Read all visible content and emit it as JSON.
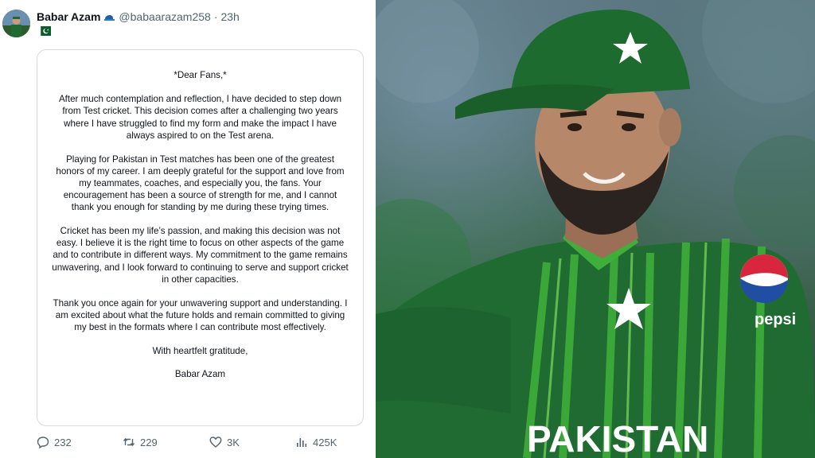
{
  "tweet": {
    "display_name": "Babar Azam",
    "handle": "@babaarazam258",
    "separator": "·",
    "time": "23h",
    "verified_icon": "cricket-cap-icon",
    "flag_icon": "pakistan-flag-icon",
    "letter": {
      "salutation": "*Dear Fans,*",
      "paragraphs": [
        "After much contemplation and reflection, I have decided to step down from Test cricket. This decision comes after a challenging two years where I have struggled to find my form and make the impact I have always aspired to on the Test arena.",
        "Playing for Pakistan in Test matches has been one of the greatest honors of my career. I am deeply grateful for the support and love from my teammates, coaches, and especially you, the fans. Your encouragement has been a source of strength for me, and I cannot thank you enough for standing by me during these trying times.",
        "Cricket has been my life’s passion, and making this decision was not easy. I believe it is the right time to focus on other aspects of the game and to contribute in different ways. My commitment to the game remains unwavering, and I look forward to continuing to serve and support cricket in other capacities.",
        "Thank you once again for your unwavering support and understanding. I am excited about what the future holds and remain committed to giving my best in the formats where I can contribute most effectively."
      ],
      "closing": "With heartfelt gratitude,",
      "signature": "Babar Azam"
    },
    "actions": {
      "replies": "232",
      "reposts": "229",
      "likes": "3K",
      "views": "425K"
    }
  },
  "photo": {
    "jersey_text": "PAKISTAN",
    "sponsor_text": "pepsi",
    "colors": {
      "jersey_green": "#1f6b32",
      "stripe_green": "#3fae3a",
      "cap_green": "#1d6b2f"
    }
  }
}
